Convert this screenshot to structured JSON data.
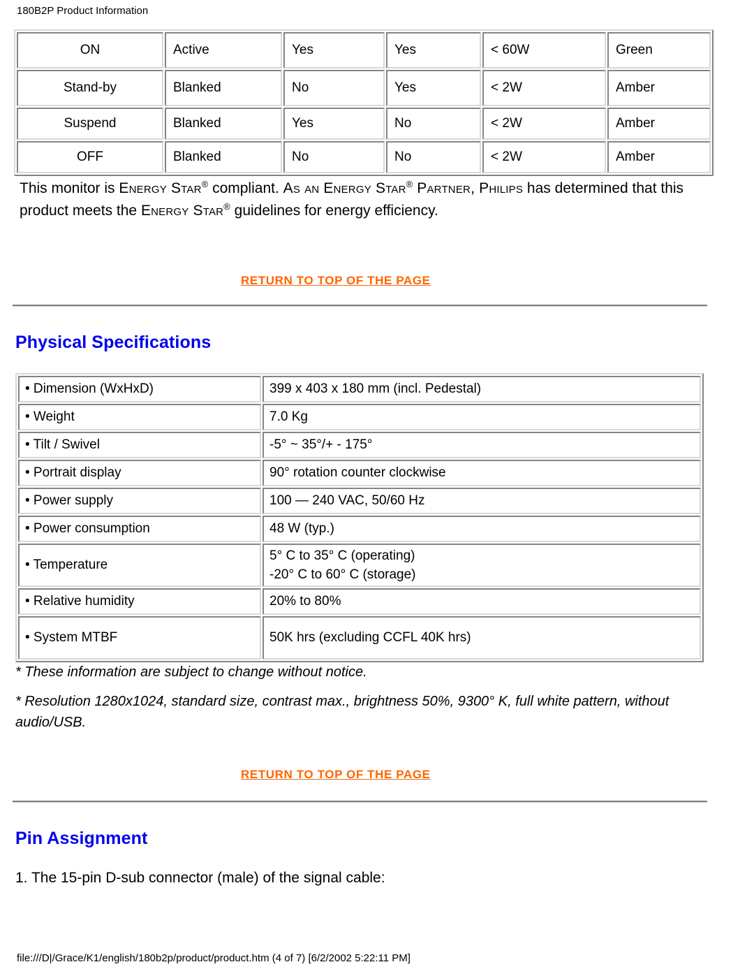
{
  "document": {
    "header_title": "180B2P Product Information",
    "footer_path": "file:///D|/Grace/K1/english/180b2p/product/product.htm (4 of 7) [6/2/2002 5:22:11 PM]"
  },
  "colors": {
    "link": "#ff6600",
    "heading": "#0000ee",
    "rule": "#808080",
    "text": "#000000"
  },
  "power_management_table": {
    "rows": [
      {
        "mode": "ON",
        "video": "Active",
        "hsync": "Yes",
        "vsync": "Yes",
        "power": "< 60W",
        "led": "Green"
      },
      {
        "mode": "Stand-by",
        "video": "Blanked",
        "hsync": "No",
        "vsync": "Yes",
        "power": "< 2W",
        "led": "Amber"
      },
      {
        "mode": "Suspend",
        "video": "Blanked",
        "hsync": "Yes",
        "vsync": "No",
        "power": "< 2W",
        "led": "Amber"
      },
      {
        "mode": "OFF",
        "video": "Blanked",
        "hsync": "No",
        "vsync": "No",
        "power": "< 2W",
        "led": "Amber"
      }
    ]
  },
  "energy_star": {
    "line1_a": "This monitor is ",
    "line1_b": "Energy Star",
    "line1_c": " compliant. ",
    "line1_d": "As an ",
    "line1_e": "Energy Star",
    "line1_f": " Partner, ",
    "line1_g": "Philips",
    "line1_h": " has determined that this product meets the ",
    "line1_i": "Energy Star",
    "line1_j": " guidelines for energy efficiency.",
    "registered_mark": "®"
  },
  "links": {
    "return_to_top_1": "RETURN TO TOP OF THE PAGE",
    "return_to_top_2": "RETURN TO TOP OF THE PAGE"
  },
  "sections": {
    "physical_specifications_heading": "Physical Specifications",
    "pin_assignment_heading": "Pin Assignment"
  },
  "physical_specifications_table": {
    "rows": [
      {
        "label": "• Dimension (WxHxD)",
        "value": "399 x 403 x 180 mm (incl. Pedestal)",
        "value2": ""
      },
      {
        "label": "• Weight",
        "value": "7.0 Kg",
        "value2": ""
      },
      {
        "label": "• Tilt / Swivel",
        "value": "-5° ~ 35°/+ - 175°",
        "value2": ""
      },
      {
        "label": "• Portrait display",
        "value": "90° rotation counter clockwise",
        "value2": ""
      },
      {
        "label": "• Power supply",
        "value": "100 — 240 VAC, 50/60 Hz",
        "value2": ""
      },
      {
        "label": "• Power consumption",
        "value": "48 W (typ.)",
        "value2": ""
      },
      {
        "label": "• Temperature",
        "value": "5° C to 35° C (operating)",
        "value2": "-20° C to 60° C (storage)"
      },
      {
        "label": "• Relative humidity",
        "value": "20% to 80%",
        "value2": ""
      },
      {
        "label": "• System MTBF",
        "value": "50K hrs (excluding CCFL 40K hrs)",
        "value2": ""
      }
    ]
  },
  "notes": {
    "note_1": "* These information are subject to change without notice.",
    "note_2": "* Resolution 1280x1024, standard size, contrast max., brightness 50%, 9300° K, full white pattern, without audio/USB."
  },
  "pin_assignment": {
    "intro": "1. The 15-pin D-sub connector (male) of the signal cable:"
  }
}
